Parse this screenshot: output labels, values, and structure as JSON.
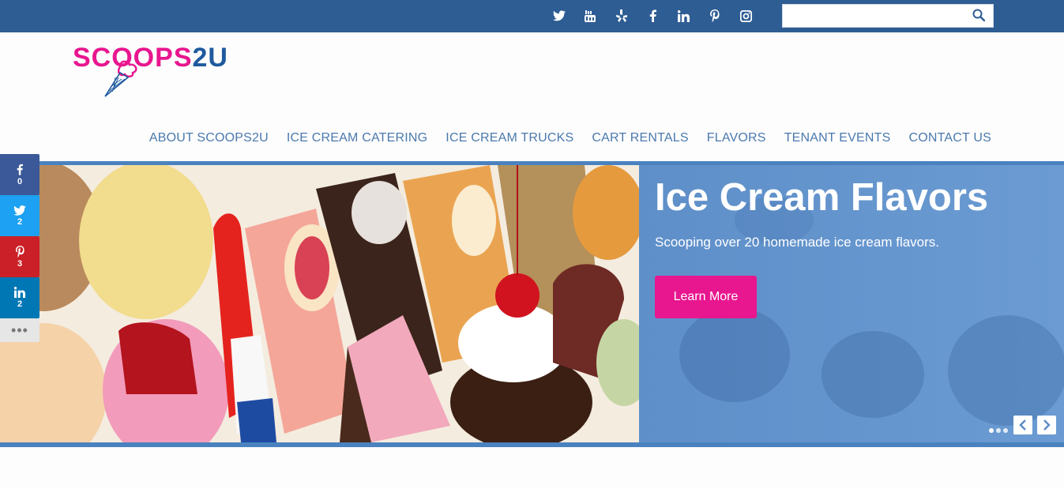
{
  "brand": {
    "logo_letters_pink": "SC",
    "logo_letters_oo": "OO",
    "logo_letters_ps": "PS",
    "logo_letters_2u": "2U"
  },
  "topbar": {
    "social_icons": [
      "twitter-icon",
      "youtube-icon",
      "yelp-icon",
      "facebook-icon",
      "linkedin-icon",
      "pinterest-icon",
      "instagram-icon"
    ],
    "search_value": "",
    "search_placeholder": ""
  },
  "nav": {
    "items": [
      "ABOUT SCOOPS2U",
      "ICE CREAM CATERING",
      "ICE CREAM TRUCKS",
      "CART RENTALS",
      "FLAVORS",
      "TENANT EVENTS",
      "CONTACT US"
    ]
  },
  "hero": {
    "title": "Ice Cream Flavors",
    "subtitle": "Scooping over 20 homemade ice cream flavors.",
    "button_label": "Learn More",
    "slide_count": 3,
    "active_slide": 1
  },
  "share": {
    "facebook_count": "0",
    "twitter_count": "2",
    "pinterest_count": "3",
    "linkedin_count": "2",
    "more_label": "•••"
  },
  "colors": {
    "topbar": "#2e5d94",
    "pink": "#e8168f",
    "nav_text": "#4b79ad",
    "hero_blue": "#5b8cc6"
  }
}
